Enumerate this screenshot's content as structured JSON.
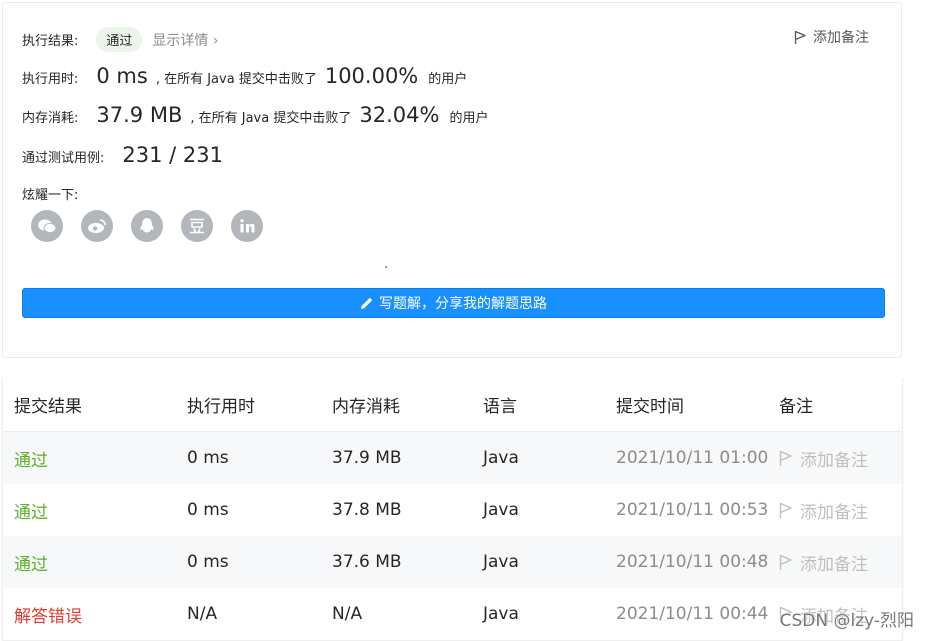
{
  "summary": {
    "result_label": "执行结果:",
    "result_value": "通过",
    "details_link": "显示详情 ›",
    "add_note": "添加备注",
    "runtime": {
      "label": "执行用时:",
      "value": "0 ms",
      "middle": ", 在所有 Java 提交中击败了",
      "percent": "100.00%",
      "suffix": "的用户"
    },
    "memory": {
      "label": "内存消耗:",
      "value": "37.9 MB",
      "middle": ", 在所有 Java 提交中击败了",
      "percent": "32.04%",
      "suffix": "的用户"
    },
    "tests": {
      "label": "通过测试用例:",
      "value": "231 / 231"
    },
    "share_label": "炫耀一下:",
    "share_icons": [
      "wechat-icon",
      "weibo-icon",
      "qq-icon",
      "douban-icon",
      "linkedin-icon"
    ],
    "write_solution_button": "写题解，分享我的解题思路"
  },
  "table": {
    "headers": [
      "提交结果",
      "执行用时",
      "内存消耗",
      "语言",
      "提交时间",
      "备注"
    ],
    "rows": [
      {
        "status": "通过",
        "runtime": "0 ms",
        "memory": "37.9 MB",
        "language": "Java",
        "time": "2021/10/11 01:00",
        "note": "添加备注"
      },
      {
        "status": "通过",
        "runtime": "0 ms",
        "memory": "37.8 MB",
        "language": "Java",
        "time": "2021/10/11 00:53",
        "note": "添加备注"
      },
      {
        "status": "通过",
        "runtime": "0 ms",
        "memory": "37.6 MB",
        "language": "Java",
        "time": "2021/10/11 00:48",
        "note": "添加备注"
      },
      {
        "status": "解答错误",
        "runtime": "N/A",
        "memory": "N/A",
        "language": "Java",
        "time": "2021/10/11 00:44",
        "note": "添加备注"
      }
    ]
  },
  "watermark": "CSDN @lzy-烈阳",
  "colors": {
    "accent": "#1890ff",
    "pass": "#5cb02b",
    "fail": "#e23c2f"
  }
}
